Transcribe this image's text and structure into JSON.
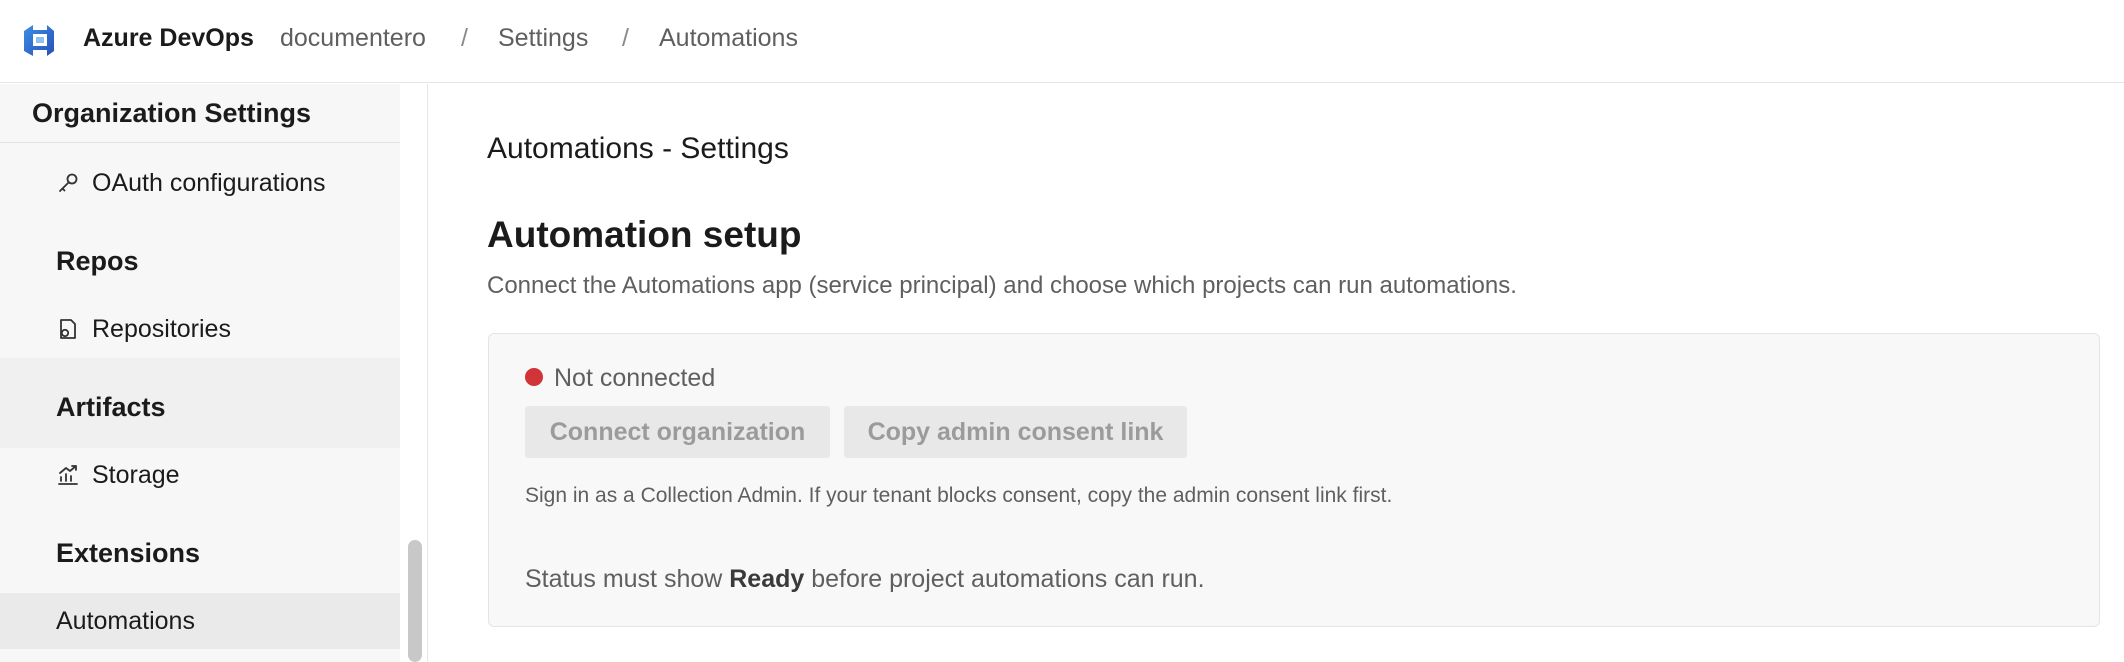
{
  "header": {
    "brand": "Azure DevOps",
    "breadcrumbs": [
      "documentero",
      "Settings",
      "Automations"
    ],
    "separator": "/"
  },
  "sidebar": {
    "title": "Organization Settings",
    "items": [
      {
        "label": "OAuth configurations",
        "icon": "key-icon"
      },
      {
        "group": "Repos"
      },
      {
        "label": "Repositories",
        "icon": "repo-icon"
      },
      {
        "group": "Artifacts"
      },
      {
        "label": "Storage",
        "icon": "chart-icon"
      },
      {
        "group": "Extensions"
      },
      {
        "label": "Automations",
        "selected": true
      }
    ]
  },
  "main": {
    "page_heading": "Automations - Settings",
    "section_title": "Automation setup",
    "section_description": "Connect the Automations app (service principal) and choose which projects can run automations.",
    "card": {
      "status": "Not connected",
      "status_color": "#d13438",
      "connect_button": "Connect organization",
      "copy_button": "Copy admin consent link",
      "hint": "Sign in as a Collection Admin. If your tenant blocks consent, copy the admin consent link first.",
      "note_prefix": "Status must show ",
      "note_bold": "Ready",
      "note_suffix": " before project automations can run."
    }
  },
  "colors": {
    "accent": "#0078d4",
    "sidebar_bg": "#f7f7f7",
    "selected_bg": "#eaeaea"
  }
}
